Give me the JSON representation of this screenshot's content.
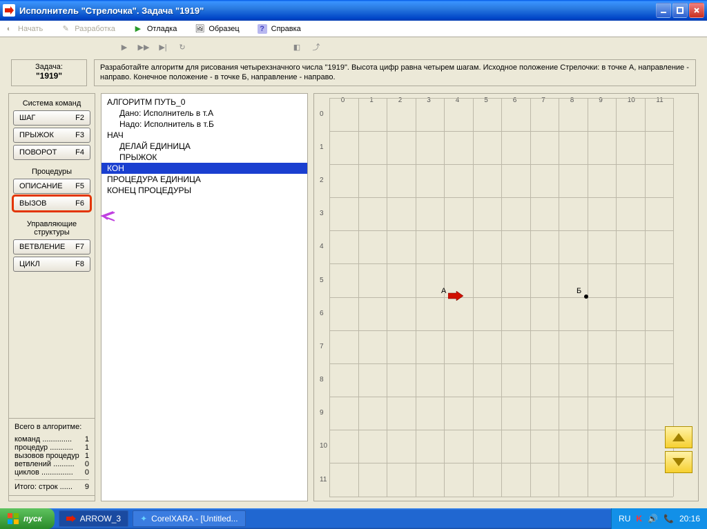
{
  "window": {
    "title": "Исполнитель \"Стрелочка\".   Задача  \"1919\""
  },
  "menu": {
    "start": "Начать",
    "develop": "Разработка",
    "debug": "Отладка",
    "sample": "Образец",
    "help": "Справка"
  },
  "task": {
    "label": "Задача:",
    "id": "\"1919\"",
    "text": "Разработайте алгоритм для рисования четырехзначного числа \"1919\". Высота цифр равна четырем шагам. Исходное положение Стрелочки: в точке А, направление - направо. Конечное положение - в  точке Б, направление - направо."
  },
  "commands": {
    "group1_title": "Система команд",
    "items1": [
      {
        "label": "ШАГ",
        "key": "F2"
      },
      {
        "label": "ПРЫЖОК",
        "key": "F3"
      },
      {
        "label": "ПОВОРОТ",
        "key": "F4"
      }
    ],
    "group2_title": "Процедуры",
    "items2": [
      {
        "label": "ОПИСАНИЕ",
        "key": "F5"
      },
      {
        "label": "ВЫЗОВ",
        "key": "F6"
      }
    ],
    "group3_title": "Управляющие структуры",
    "items3": [
      {
        "label": "ВЕТВЛЕНИЕ",
        "key": "F7"
      },
      {
        "label": "ЦИКЛ",
        "key": "F8"
      }
    ]
  },
  "code": {
    "l0": "АЛГОРИТМ ПУТЬ_0",
    "l1": "Дано: Исполнитель в т.А",
    "l2": "Надо: Исполнитель в т.Б",
    "l3": "НАЧ",
    "l4": "ДЕЛАЙ ЕДИНИЦА",
    "l5": "ПРЫЖОК",
    "l6": "КОН",
    "l7": "ПРОЦЕДУРА ЕДИНИЦА",
    "l8": "КОНЕЦ ПРОЦЕДУРЫ"
  },
  "grid": {
    "xticks": [
      "0",
      "1",
      "2",
      "3",
      "4",
      "5",
      "6",
      "7",
      "8",
      "9",
      "10",
      "11"
    ],
    "yticks": [
      "0",
      "1",
      "2",
      "3",
      "4",
      "5",
      "6",
      "7",
      "8",
      "9",
      "10",
      "11"
    ],
    "pointA": "А",
    "pointB": "Б"
  },
  "stats": {
    "title": "Всего в алгоритме:",
    "rows": [
      {
        "k": "команд",
        "dots": "..............",
        "v": "1"
      },
      {
        "k": "процедур",
        "dots": "...........",
        "v": "1"
      },
      {
        "k": "вызовов процедур",
        "dots": "",
        "v": "1"
      },
      {
        "k": "ветвлений",
        "dots": "..........",
        "v": "0"
      },
      {
        "k": "циклов",
        "dots": "...............",
        "v": "0"
      }
    ],
    "total_k": "Итого:  строк",
    "total_dots": "......",
    "total_v": "9"
  },
  "taskbar": {
    "start": "пуск",
    "task1": "ARROW_3",
    "task2": "CorelXARA - [Untitled...",
    "lang": "RU",
    "clock": "20:16"
  }
}
